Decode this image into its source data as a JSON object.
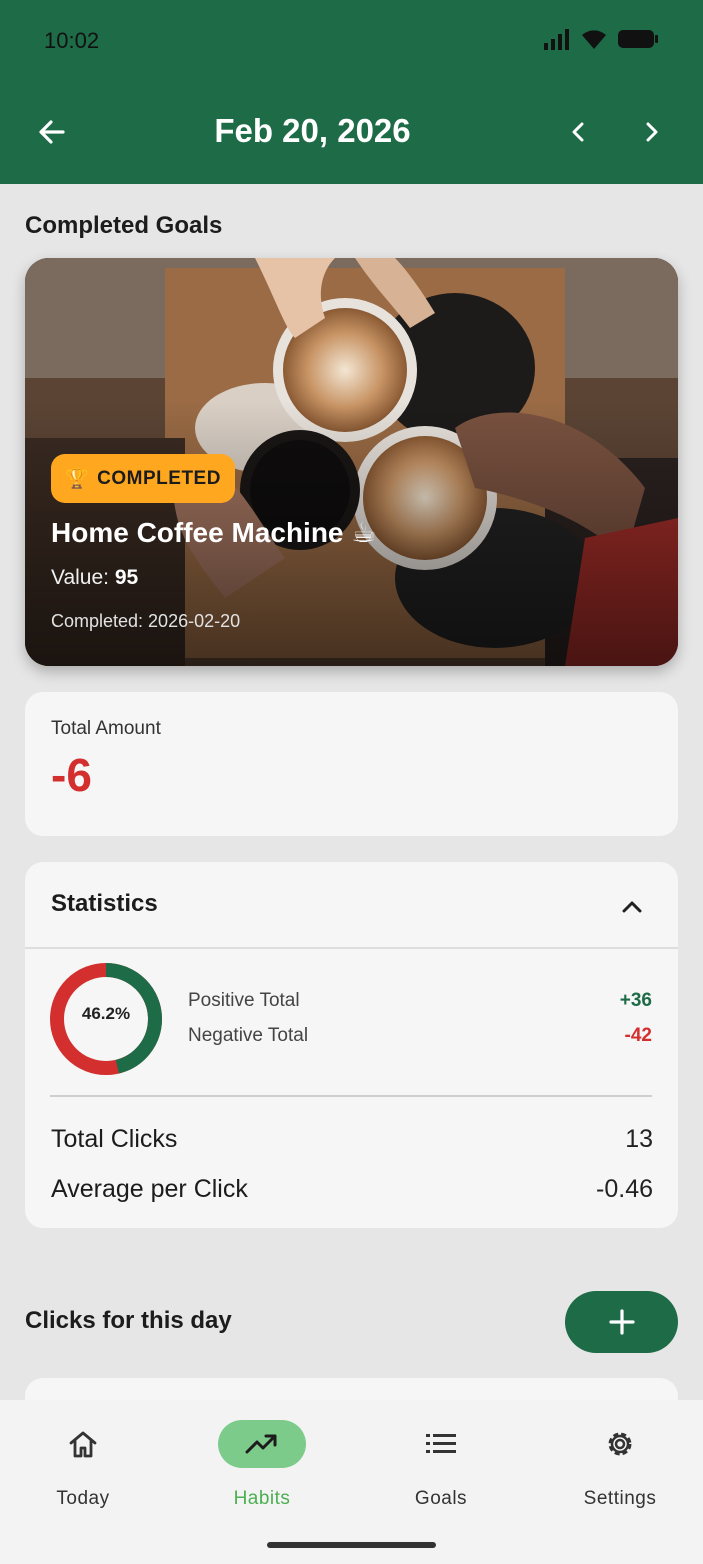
{
  "status_bar": {
    "time": "10:02"
  },
  "header": {
    "date_title": "Feb 20, 2026"
  },
  "completed_goals": {
    "section_title": "Completed Goals",
    "card": {
      "badge_icon": "🏆",
      "badge_label": "COMPLETED",
      "name": "Home Coffee Machine ☕",
      "value_label": "Value:",
      "value": "95",
      "completed_text": "Completed: 2026-02-20"
    }
  },
  "total": {
    "label": "Total Amount",
    "value": "-6"
  },
  "statistics": {
    "title": "Statistics",
    "donut_percent": "46.2%",
    "positive_fraction": 0.462,
    "positive_label": "Positive Total",
    "positive_value": "+36",
    "negative_label": "Negative Total",
    "negative_value": "-42",
    "total_clicks_label": "Total Clicks",
    "total_clicks_value": "13",
    "avg_label": "Average per Click",
    "avg_value": "-0.46"
  },
  "clicks": {
    "section_title": "Clicks for this day"
  },
  "nav": {
    "items": [
      {
        "label": "Today",
        "icon": "home-icon"
      },
      {
        "label": "Habits",
        "icon": "trending-up-icon"
      },
      {
        "label": "Goals",
        "icon": "list-icon"
      },
      {
        "label": "Settings",
        "icon": "gear-icon"
      }
    ],
    "active": "Habits"
  },
  "colors": {
    "primary": "#1e6b48",
    "negative": "#d32f2f",
    "badge": "#ffa81f",
    "nav_active_pill": "#7ccb8b"
  }
}
